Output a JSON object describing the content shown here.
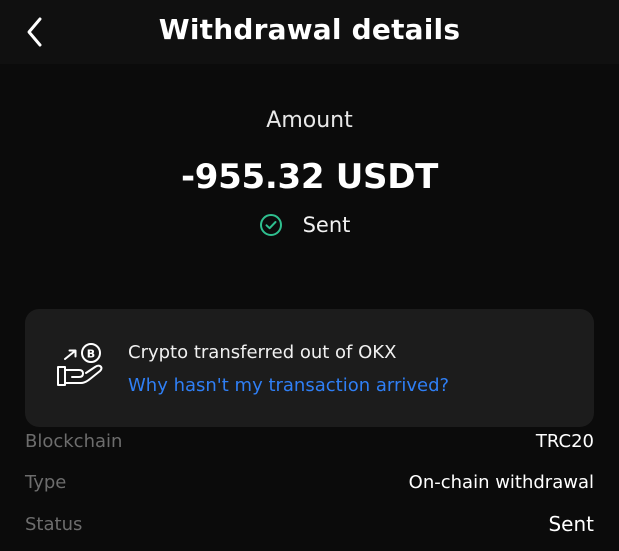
{
  "header": {
    "title": "Withdrawal details",
    "back_icon": "chevron-left-icon"
  },
  "amount": {
    "label": "Amount",
    "value": "-955.32 USDT",
    "status_text": "Sent",
    "status_icon": "check-circle-icon",
    "status_color": "#2fbf8f"
  },
  "info_card": {
    "icon": "hand-crypto-icon",
    "title": "Crypto transferred out of OKX",
    "link": "Why hasn't my transaction arrived?",
    "link_color": "#2f7ff5"
  },
  "details": [
    {
      "label": "Blockchain",
      "value": "TRC20"
    },
    {
      "label": "Type",
      "value": "On-chain withdrawal"
    },
    {
      "label": "Status",
      "value": "Sent"
    }
  ]
}
